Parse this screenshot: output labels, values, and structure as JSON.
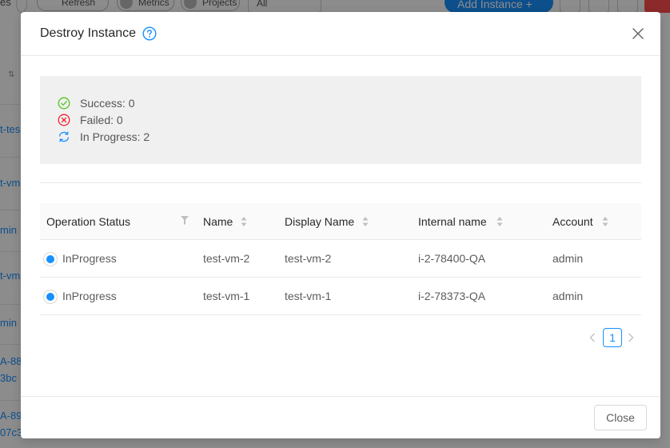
{
  "background": {
    "toolbar": {
      "left_text": "es",
      "refresh_label": "Refresh",
      "metrics_label": "Metrics",
      "projects_label": "Projects",
      "filter_value": "All",
      "add_instance_label": "Add Instance"
    },
    "row_links": [
      "t-tes",
      "t-vm",
      "min",
      "t-vm",
      "min",
      "A-88",
      "3bc",
      "A-89",
      "07c3"
    ]
  },
  "modal": {
    "title": "Destroy Instance",
    "summary": {
      "success": "Success: 0",
      "failed": "Failed: 0",
      "in_progress": "In Progress: 2"
    },
    "table": {
      "columns": [
        "Operation Status",
        "Name",
        "Display Name",
        "Internal name",
        "Account"
      ],
      "rows": [
        {
          "status": "InProgress",
          "name": "test-vm-2",
          "display_name": "test-vm-2",
          "internal_name": "i-2-78400-QA",
          "account": "admin"
        },
        {
          "status": "InProgress",
          "name": "test-vm-1",
          "display_name": "test-vm-1",
          "internal_name": "i-2-78373-QA",
          "account": "admin"
        }
      ]
    },
    "pagination": {
      "current_page": "1"
    },
    "close_button": "Close"
  },
  "colors": {
    "primary": "#1890ff",
    "success": "#52c41a",
    "error": "#f5222d"
  },
  "icons": {
    "help": "question-circle-icon",
    "close": "close-icon",
    "success": "check-circle-icon",
    "failed": "close-circle-icon",
    "in_progress": "sync-icon"
  }
}
